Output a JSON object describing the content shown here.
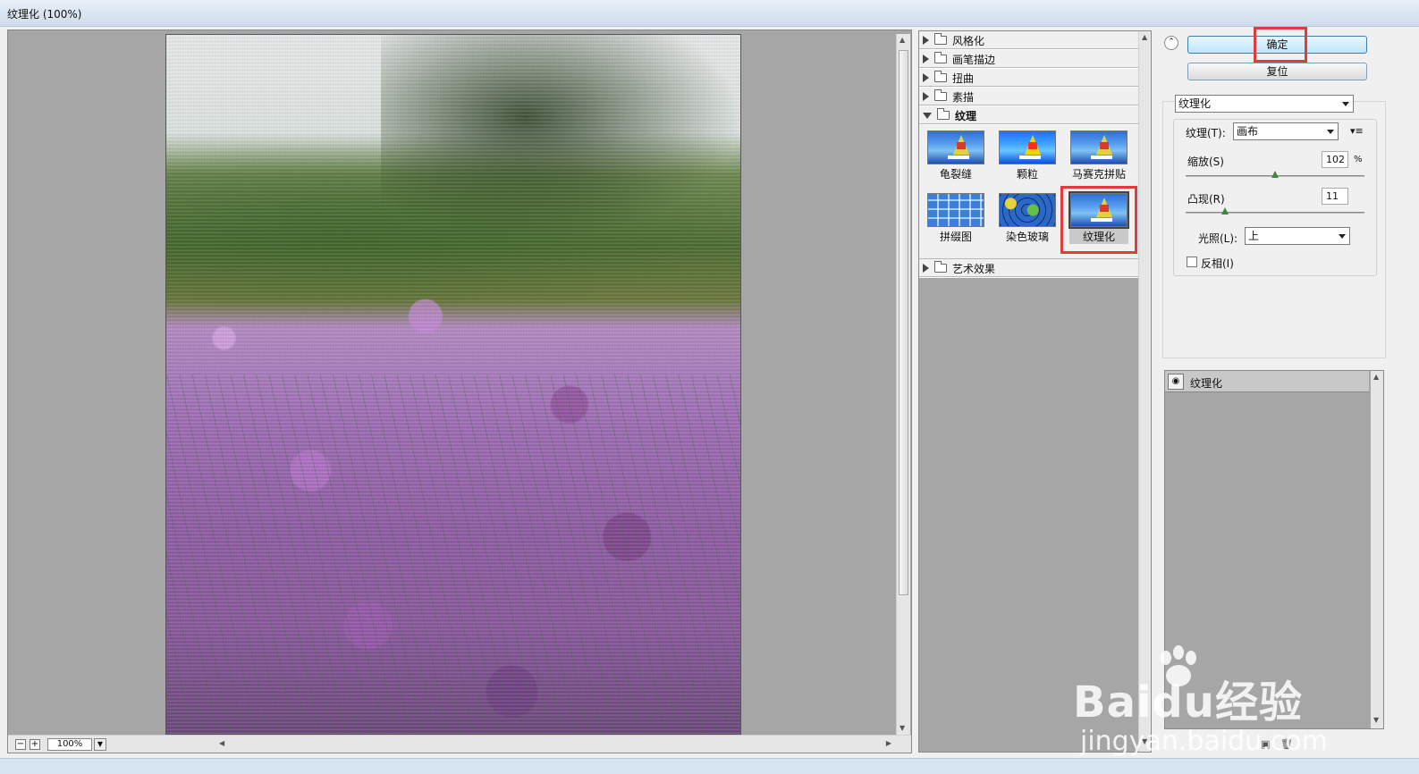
{
  "window": {
    "title": "纹理化 (100%)"
  },
  "preview": {
    "zoom": "100%",
    "zoom_minus": "−",
    "zoom_plus": "+"
  },
  "filters": {
    "categories": [
      {
        "label": "风格化",
        "open": false
      },
      {
        "label": "画笔描边",
        "open": false
      },
      {
        "label": "扭曲",
        "open": false
      },
      {
        "label": "素描",
        "open": false
      },
      {
        "label": "纹理",
        "open": true
      },
      {
        "label": "艺术效果",
        "open": false
      }
    ],
    "texture_items": [
      {
        "label": "龟裂缝",
        "selected": false
      },
      {
        "label": "颗粒",
        "selected": false
      },
      {
        "label": "马赛克拼贴",
        "selected": false
      },
      {
        "label": "拼缀图",
        "selected": false
      },
      {
        "label": "染色玻璃",
        "selected": false
      },
      {
        "label": "纹理化",
        "selected": true
      }
    ]
  },
  "buttons": {
    "ok": "确定",
    "reset": "复位"
  },
  "settings": {
    "filter_select": "纹理化",
    "texture_label": "纹理(T):",
    "texture_value": "画布",
    "scaling_label": "缩放(S)",
    "scaling_value": "102",
    "scaling_unit": "%",
    "scaling_level": 0.5,
    "relief_label": "凸现(R)",
    "relief_value": "11",
    "relief_level": 0.22,
    "light_label": "光照(L):",
    "light_value": "上",
    "invert_label": "反相(I)",
    "invert_checked": false
  },
  "layers": {
    "items": [
      {
        "label": "纹理化",
        "visible": true
      }
    ]
  },
  "watermark": {
    "main": "Baidu经验",
    "sub": "jingyan.baidu.com"
  },
  "colors": {
    "highlight": "#e23b3b",
    "ok_border": "#3c7fb1"
  }
}
